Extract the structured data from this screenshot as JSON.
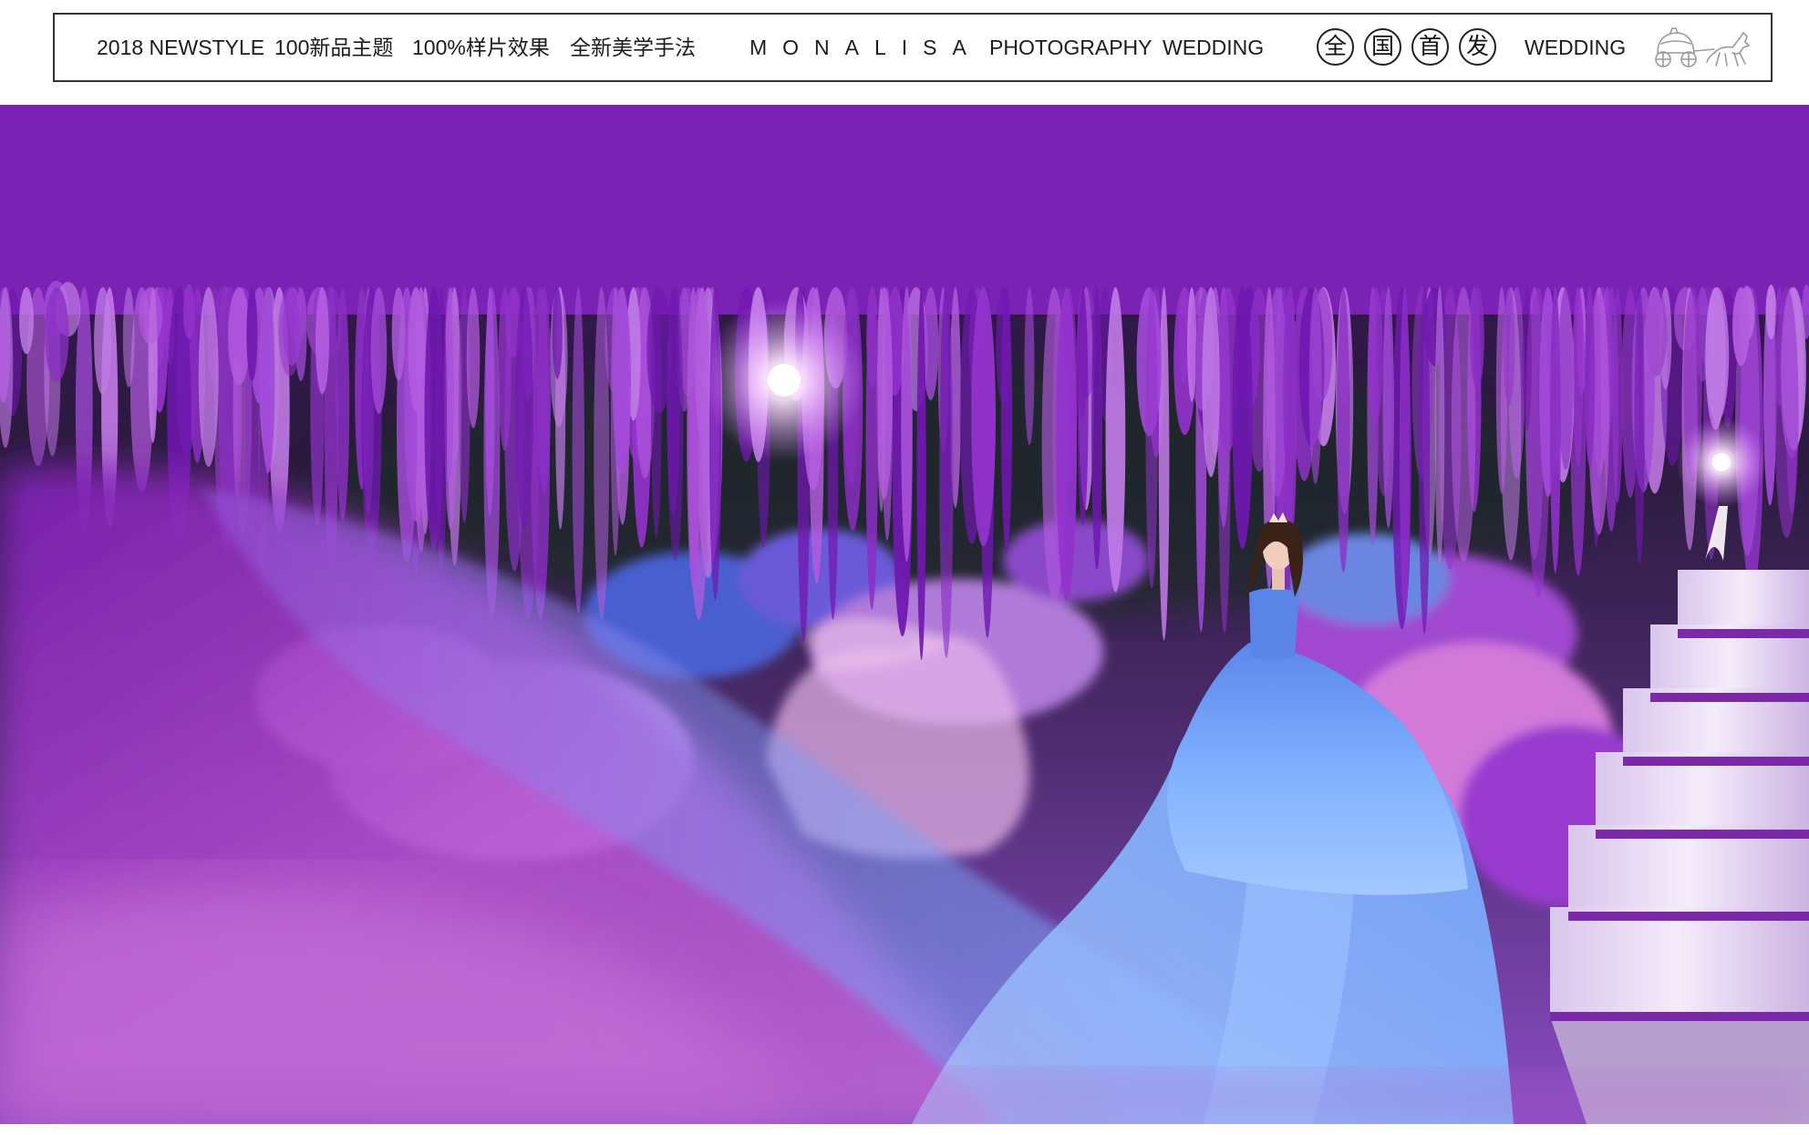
{
  "header": {
    "newstyle": "2018 NEWSTYLE",
    "themes": "100新品主题",
    "effect": "100%样片效果",
    "method": "全新美学手法",
    "brand": "MONALISA",
    "photography": "PHOTOGRAPHY",
    "wedding_left": "WEDDING",
    "release_chars": [
      "全",
      "国",
      "首",
      "发"
    ],
    "wedding_right": "WEDDING",
    "logo_icon": "carriage-icon"
  },
  "photo": {
    "subject": "bride-in-blue-gown",
    "palette": {
      "wisteria": "#8a2fc4",
      "wisteria_light": "#c98ae8",
      "gown": "#6f9ef5",
      "fog": "#b04ad0",
      "background": "#2a1240"
    }
  }
}
